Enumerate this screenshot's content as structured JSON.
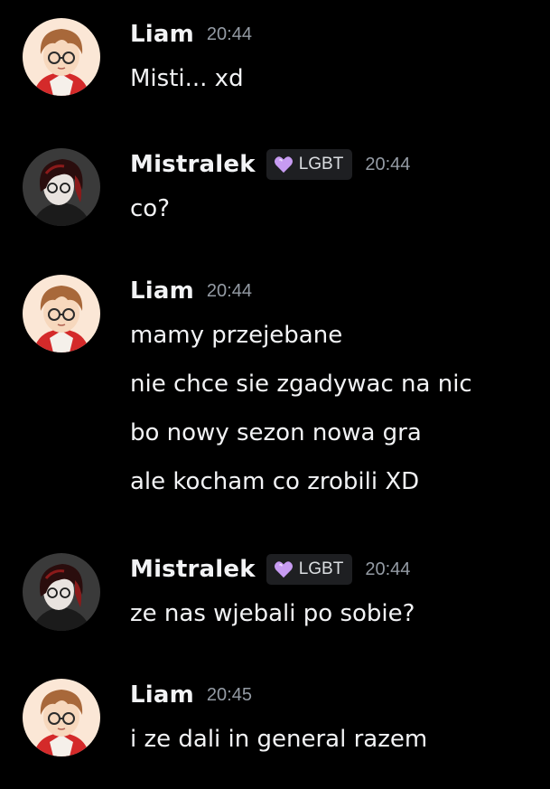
{
  "messages": [
    {
      "author": "Liam",
      "avatar_icon": "liam-avatar-icon",
      "badge": null,
      "time": "20:44",
      "lines": [
        "Misti... xd"
      ]
    },
    {
      "author": "Mistralek",
      "avatar_icon": "mistralek-avatar-icon",
      "badge": {
        "icon": "purple-heart-icon",
        "label": "LGBT"
      },
      "time": "20:44",
      "lines": [
        "co?"
      ]
    },
    {
      "author": "Liam",
      "avatar_icon": "liam-avatar-icon",
      "badge": null,
      "time": "20:44",
      "lines": [
        "mamy przejebane",
        "nie chce sie zgadywac na nic",
        "bo nowy sezon nowa gra",
        "ale kocham co zrobili XD"
      ]
    },
    {
      "author": "Mistralek",
      "avatar_icon": "mistralek-avatar-icon",
      "badge": {
        "icon": "purple-heart-icon",
        "label": "LGBT"
      },
      "time": "20:44",
      "lines": [
        "ze nas wjebali po sobie?"
      ]
    },
    {
      "author": "Liam",
      "avatar_icon": "liam-avatar-icon",
      "badge": null,
      "time": "20:45",
      "lines": [
        "i ze dali in general razem"
      ]
    }
  ],
  "colors": {
    "background": "#000000",
    "text": "#f2f3f5",
    "timestamp": "#949ba4",
    "badge_bg": "#1e1f22",
    "heart": "#c79bf2"
  }
}
